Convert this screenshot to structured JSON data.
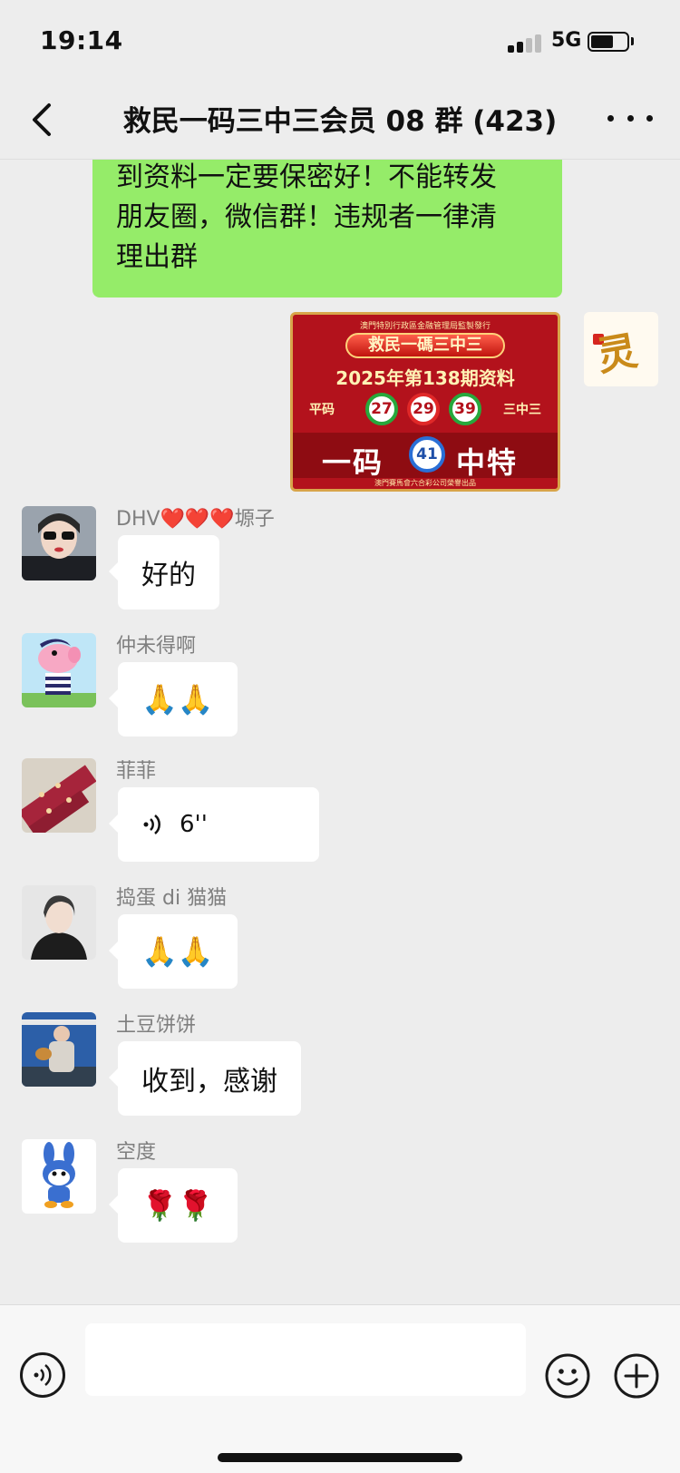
{
  "status_bar": {
    "time": "19:14",
    "network": "5G",
    "battery_percent": 62
  },
  "header": {
    "title": "救民一码三中三会员 08 群 (423)"
  },
  "messages": {
    "mine_text": {
      "line1": "到资料一定要保密好！不能转发",
      "line2": "朋友圈，微信群！违规者一律清",
      "line3": "理出群"
    },
    "mine_image": {
      "top_text": "澳門特別行政區金融管理局監製發行",
      "ribbon": "救民一碼三中三",
      "period": "2025年第138期资料",
      "flat_label": "平码",
      "three_label": "三中三",
      "balls": [
        "27",
        "29",
        "39"
      ],
      "one_label": "一码",
      "special_ball": "41",
      "special_label": "中特",
      "footer": "澳門賽馬會六合彩公司榮譽出品"
    },
    "others": [
      {
        "sender": "DHV❤️❤️❤️塬子",
        "content": "好的"
      },
      {
        "sender": "仲未得啊",
        "content": "🙏🙏"
      },
      {
        "sender": "菲菲",
        "content": "6''"
      },
      {
        "sender": "捣蛋 di 猫猫",
        "content": "🙏🙏"
      },
      {
        "sender": "土豆饼饼",
        "content": "收到，感谢"
      },
      {
        "sender": "空度",
        "content": "🌹🌹"
      }
    ]
  },
  "colors": {
    "my_bubble": "#95ec69",
    "background": "#ededed",
    "other_bubble": "#ffffff"
  }
}
